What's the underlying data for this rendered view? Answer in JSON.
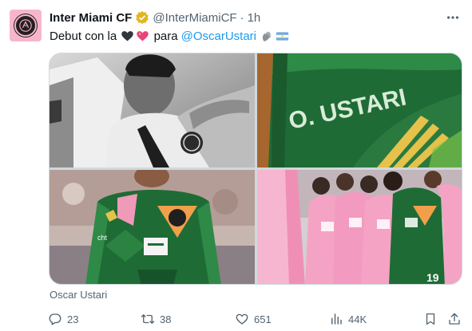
{
  "author": {
    "name": "Inter Miami CF",
    "handle": "@InterMiamiCF",
    "separator": "·",
    "time": "1h",
    "verified": true,
    "avatar_color": "#f7b5cd"
  },
  "tweet": {
    "text_prefix": "Debut con la",
    "text_middle": "para",
    "mention": "@OscarUstari",
    "emojis": [
      "black-heart-icon",
      "pink-heart-icon",
      "waving-hand-icon",
      "argentina-flag-icon"
    ]
  },
  "media": {
    "images": [
      {
        "alt": "bw-celebration-photo"
      },
      {
        "alt": "green-jersey-closeup-photo"
      },
      {
        "alt": "goalkeeper-green-kit-photo"
      },
      {
        "alt": "team-huddle-pink-kits-photo"
      }
    ],
    "jersey_text": "O. USTARI",
    "caption": "Oscar Ustari"
  },
  "actions": {
    "replies": "23",
    "reposts": "38",
    "likes": "651",
    "views": "44K"
  },
  "colors": {
    "text": "#0f1419",
    "secondary": "#536471",
    "link": "#1d9bf0",
    "verified_gold": "#e2b719",
    "kit_green": "#1f6b35",
    "kit_pink": "#f4a3c4"
  }
}
